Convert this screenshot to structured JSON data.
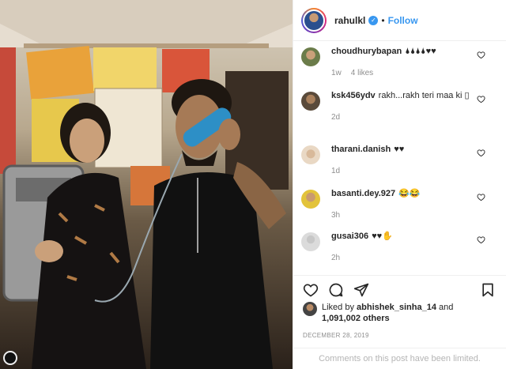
{
  "post": {
    "username": "rahulkl",
    "follow_label": "Follow",
    "separator": "•"
  },
  "comments": [
    {
      "user": "choudhurybapan",
      "text": "🌢🌢🌢🌢♥♥",
      "time": "1w",
      "likes": "4 likes"
    },
    {
      "user": "ksk456ydv",
      "text": "rakh...rakh teri maa ki ▯",
      "time": "2d",
      "likes": ""
    },
    {
      "user": "tharani.danish",
      "text": "♥♥",
      "time": "1d",
      "likes": ""
    },
    {
      "user": "basanti.dey.927",
      "text": "😂😂",
      "time": "3h",
      "likes": ""
    },
    {
      "user": "gusai306",
      "text": "♥♥✋",
      "time": "2h",
      "likes": ""
    }
  ],
  "likes": {
    "prefix": "Liked by",
    "user": "abhishek_sinha_14",
    "and": "and",
    "count": "1,091,002 others"
  },
  "date": "DECEMBER 28, 2019",
  "comments_limited": "Comments on this post have been limited.",
  "icons": [
    "heart-icon",
    "comment-icon",
    "share-icon",
    "bookmark-icon",
    "verified-icon"
  ],
  "colors": {
    "accent": "#3897f0",
    "text": "#262626",
    "muted": "#8e8e8e"
  }
}
